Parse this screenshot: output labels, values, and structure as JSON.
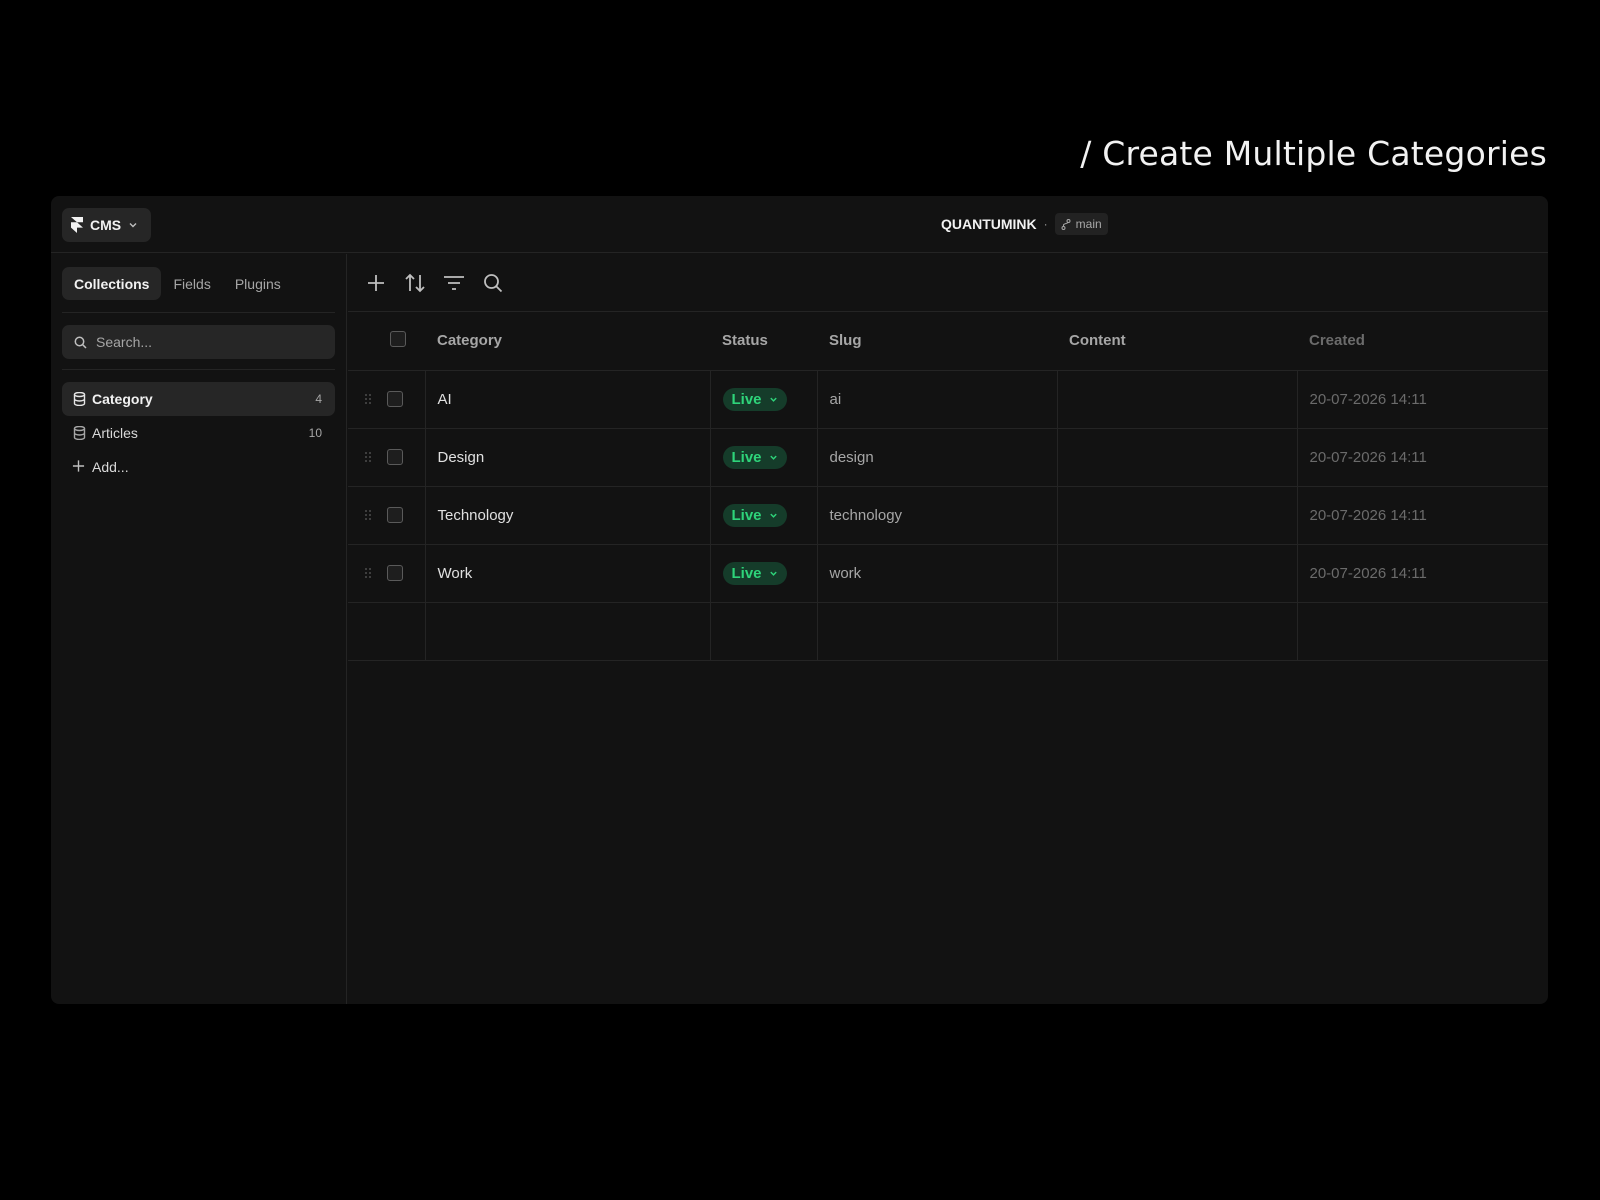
{
  "page_heading": "/ Create Multiple Categories",
  "topbar": {
    "app_label": "CMS",
    "project_name": "QUANTUMINK",
    "separator": "·",
    "branch": "main"
  },
  "sidebar": {
    "tabs": [
      {
        "label": "Collections",
        "active": true
      },
      {
        "label": "Fields",
        "active": false
      },
      {
        "label": "Plugins",
        "active": false
      }
    ],
    "search_placeholder": "Search...",
    "collections": [
      {
        "label": "Category",
        "count": "4",
        "active": true
      },
      {
        "label": "Articles",
        "count": "10",
        "active": false
      }
    ],
    "add_label": "Add..."
  },
  "toolbar": {
    "icons": [
      "plus-icon",
      "sort-icon",
      "filter-icon",
      "search-icon"
    ]
  },
  "table": {
    "headers": {
      "category": "Category",
      "status": "Status",
      "slug": "Slug",
      "content": "Content",
      "created": "Created"
    },
    "rows": [
      {
        "category": "AI",
        "status": "Live",
        "slug": "ai",
        "content": "",
        "created": "20-07-2026 14:11"
      },
      {
        "category": "Design",
        "status": "Live",
        "slug": "design",
        "content": "",
        "created": "20-07-2026 14:11"
      },
      {
        "category": "Technology",
        "status": "Live",
        "slug": "technology",
        "content": "",
        "created": "20-07-2026 14:11"
      },
      {
        "category": "Work",
        "status": "Live",
        "slug": "work",
        "content": "",
        "created": "20-07-2026 14:11"
      }
    ]
  },
  "colors": {
    "background": "#000000",
    "window": "#121212",
    "live_text": "#2ed47a",
    "live_bg": "#153c2a"
  }
}
